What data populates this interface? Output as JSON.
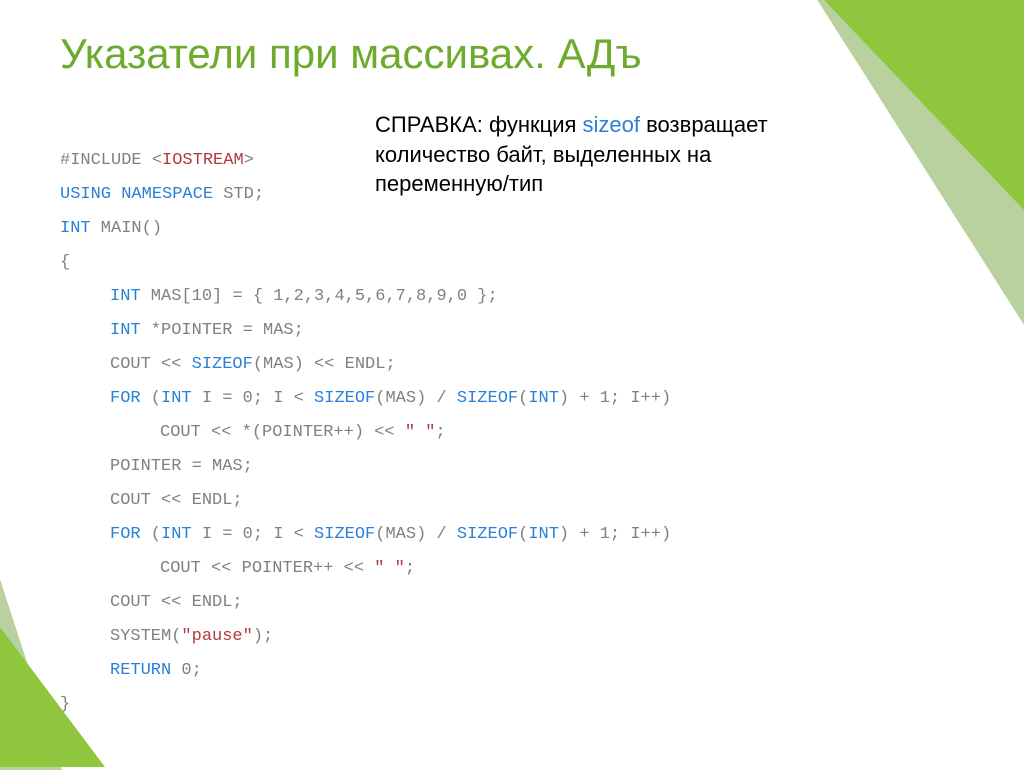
{
  "title": "Указатели при массивах. АДъ",
  "callout": {
    "label": "СПРАВКА: функция ",
    "kw": "sizeof",
    "rest": " возвращает количество байт, выделенных на переменную/тип"
  },
  "code": {
    "l1_a": "#INCLUDE <",
    "l1_b": "IOSTREAM",
    "l1_c": ">",
    "l2_a": "USING",
    "l2_b": " ",
    "l2_c": "NAMESPACE",
    "l2_d": " STD;",
    "l3_a": "INT",
    "l3_b": " MAIN()",
    "l4": "{",
    "l5_a": "INT",
    "l5_b": " MAS[10] = { 1,2,3,4,5,6,7,8,9,0 };",
    "l6_a": "INT",
    "l6_b": " *POINTER = MAS;",
    "l7_a": "COUT << ",
    "l7_b": "SIZEOF",
    "l7_c": "(MAS) << ENDL;",
    "l8_a": "FOR",
    "l8_b": " (",
    "l8_c": "INT",
    "l8_d": " I = 0; I < ",
    "l8_e": "SIZEOF",
    "l8_f": "(MAS) / ",
    "l8_g": "SIZEOF",
    "l8_h": "(",
    "l8_i": "INT",
    "l8_j": ") + 1; I++)",
    "l9_a": "COUT << *(POINTER++) << ",
    "l9_b": "\" \"",
    "l9_c": ";",
    "l10": "POINTER = MAS;",
    "l11": "COUT << ENDL;",
    "l12_a": "FOR",
    "l12_b": " (",
    "l12_c": "INT",
    "l12_d": " I = 0; I < ",
    "l12_e": "SIZEOF",
    "l12_f": "(MAS) / ",
    "l12_g": "SIZEOF",
    "l12_h": "(",
    "l12_i": "INT",
    "l12_j": ") + 1; I++)",
    "l13_a": "COUT << POINTER++ << ",
    "l13_b": "\" \"",
    "l13_c": ";",
    "l14": "COUT << ENDL;",
    "l15_a": "SYSTEM(",
    "l15_b": "\"pause\"",
    "l15_c": ");",
    "l16_a": "RETURN",
    "l16_b": " 0;",
    "l17": "}"
  }
}
